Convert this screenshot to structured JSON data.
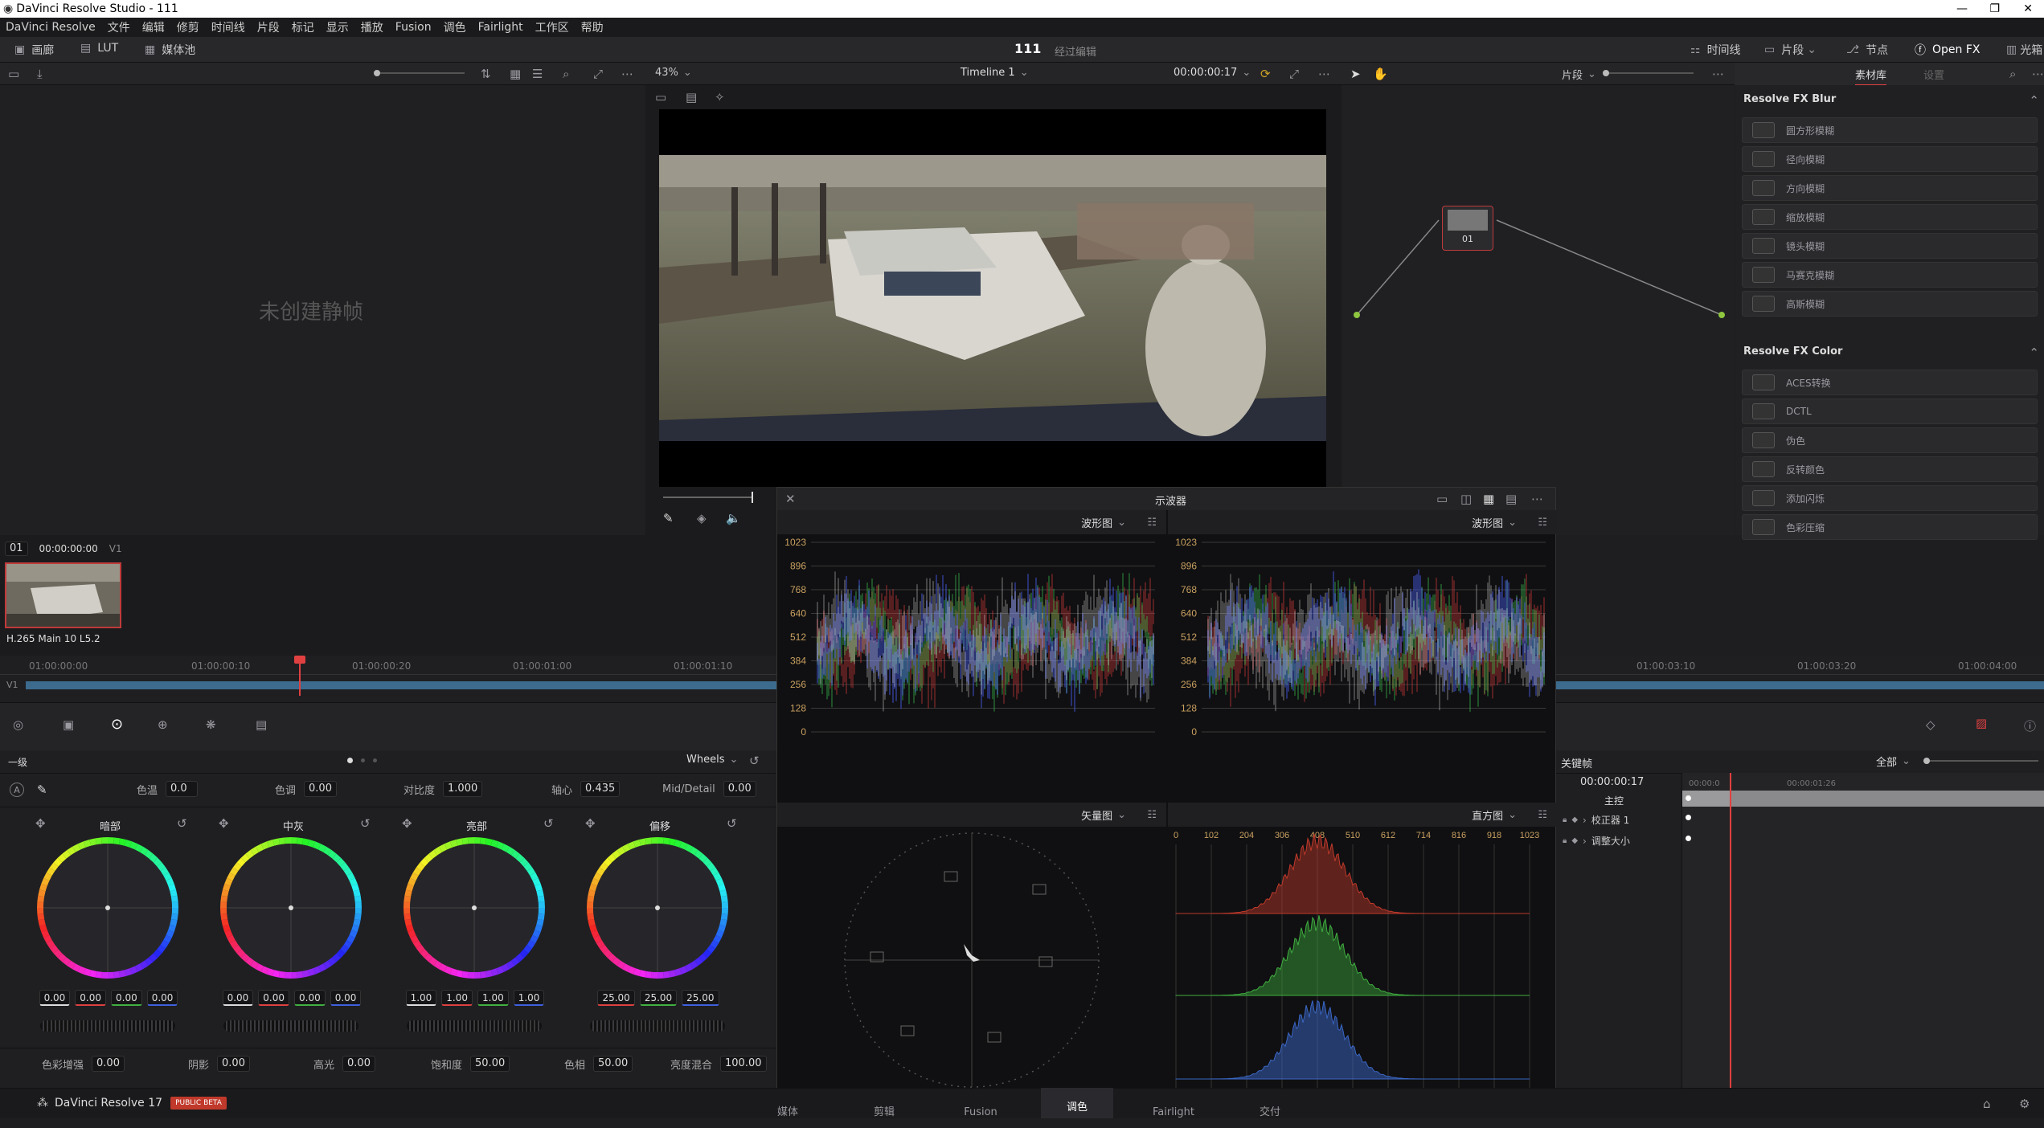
{
  "window": {
    "title": "DaVinci Resolve Studio - 111"
  },
  "menu": [
    "DaVinci Resolve",
    "文件",
    "编辑",
    "修剪",
    "时间线",
    "片段",
    "标记",
    "显示",
    "播放",
    "Fusion",
    "调色",
    "Fairlight",
    "工作区",
    "帮助"
  ],
  "pagebar": {
    "gallery": "画廊",
    "lut": "LUT",
    "mediapool": "媒体池",
    "project": "111",
    "status": "经过编辑",
    "timeline_btn": "时间线",
    "clips_btn": "片段",
    "nodes_btn": "节点",
    "openfx_btn": "Open FX",
    "lightbox_btn": "光箱"
  },
  "viewer": {
    "zoom": "43%",
    "timeline_name": "Timeline 1",
    "timecode": "00:00:00:17",
    "clip_mode": "片段"
  },
  "gallery": {
    "empty_text": "未创建静帧"
  },
  "library": {
    "tab_active": "素材库",
    "tab_settings": "设置",
    "blur_section": "Resolve FX Blur",
    "blur_items": [
      "圆方形模糊",
      "径向模糊",
      "方向模糊",
      "缩放模糊",
      "镜头模糊",
      "马赛克模糊",
      "高斯模糊"
    ],
    "color_section": "Resolve FX Color",
    "color_items": [
      "ACES转换",
      "DCTL",
      "伪色",
      "反转颜色",
      "添加闪烁",
      "色彩压缩"
    ]
  },
  "clips": {
    "index": "01",
    "timecode": "00:00:00:00",
    "track": "V1",
    "codec": "H.265 Main 10 L5.2"
  },
  "mini_timeline": {
    "ticks": [
      "01:00:00:00",
      "01:00:00:10",
      "01:00:00:20",
      "01:00:01:00",
      "01:00:01:10",
      "01:00:03:10",
      "01:00:03:20",
      "01:00:04:00"
    ],
    "track": "V1"
  },
  "scopes": {
    "title": "示波器",
    "wave1": "波形图",
    "wave2": "波形图",
    "vector": "矢量图",
    "histogram": "直方图",
    "yticks": [
      "1023",
      "896",
      "768",
      "640",
      "512",
      "384",
      "256",
      "128",
      "0"
    ],
    "hticks": [
      "0",
      "102",
      "204",
      "306",
      "408",
      "510",
      "612",
      "714",
      "816",
      "918",
      "1023"
    ]
  },
  "primaries": {
    "mode": "一级",
    "wheels_mode": "Wheels",
    "params": {
      "temp_label": "色温",
      "temp": "0.0",
      "tint_label": "色调",
      "tint": "0.00",
      "contrast_label": "对比度",
      "contrast": "1.000",
      "pivot_label": "轴心",
      "pivot": "0.435",
      "md_label": "Mid/Detail",
      "md": "0.00"
    },
    "wheels": [
      {
        "label": "暗部",
        "vals": [
          "0.00",
          "0.00",
          "0.00",
          "0.00"
        ]
      },
      {
        "label": "中灰",
        "vals": [
          "0.00",
          "0.00",
          "0.00",
          "0.00"
        ]
      },
      {
        "label": "亮部",
        "vals": [
          "1.00",
          "1.00",
          "1.00",
          "1.00"
        ]
      },
      {
        "label": "偏移",
        "vals": [
          "25.00",
          "25.00",
          "25.00"
        ]
      }
    ],
    "bottom": {
      "boost_label": "色彩增强",
      "boost": "0.00",
      "shadow_label": "阴影",
      "shadow": "0.00",
      "hl_label": "高光",
      "hl": "0.00",
      "sat_label": "饱和度",
      "sat": "50.00",
      "hue_label": "色相",
      "hue": "50.00",
      "lm_label": "亮度混合",
      "lm": "100.00"
    }
  },
  "keyframes": {
    "title": "关键帧",
    "filter": "全部",
    "tc": "00:00:00:17",
    "tc2": "00:00:01:26",
    "tc3": "00:00:0",
    "rows": [
      "主控",
      "校正器 1",
      "调整大小"
    ]
  },
  "footer": {
    "app": "DaVinci Resolve 17",
    "badge": "PUBLIC BETA",
    "tabs": [
      "媒体",
      "剪辑",
      "Fusion",
      "调色",
      "Fairlight",
      "交付"
    ],
    "active": "调色"
  }
}
